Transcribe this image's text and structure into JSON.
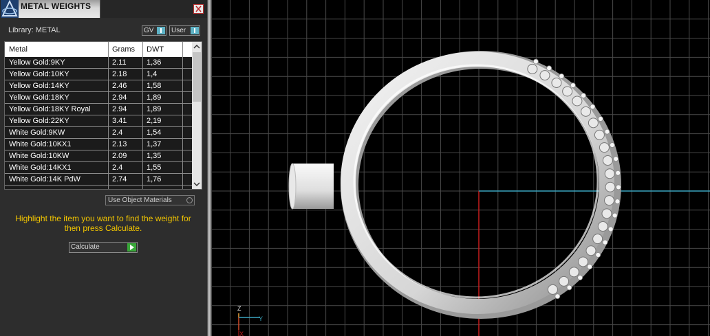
{
  "panel": {
    "title": "METAL WEIGHTS",
    "library_label": "Library: METAL",
    "toggle_gv": "GV",
    "toggle_user": "User",
    "columns": [
      "Metal",
      "Grams",
      "DWT"
    ],
    "rows": [
      {
        "metal": "Yellow Gold:9KY",
        "grams": "2.11",
        "dwt": "1,36"
      },
      {
        "metal": "Yellow Gold:10KY",
        "grams": "2.18",
        "dwt": "1,4"
      },
      {
        "metal": "Yellow Gold:14KY",
        "grams": "2.46",
        "dwt": "1,58"
      },
      {
        "metal": "Yellow Gold:18KY",
        "grams": "2.94",
        "dwt": "1,89"
      },
      {
        "metal": "Yellow Gold:18KY Royal",
        "grams": "2.94",
        "dwt": "1,89"
      },
      {
        "metal": "Yellow Gold:22KY",
        "grams": "3.41",
        "dwt": "2,19"
      },
      {
        "metal": "White Gold:9KW",
        "grams": "2.4",
        "dwt": "1,54"
      },
      {
        "metal": "White Gold:10KX1",
        "grams": "2.13",
        "dwt": "1,37"
      },
      {
        "metal": "White Gold:10KW",
        "grams": "2.09",
        "dwt": "1,35"
      },
      {
        "metal": "White Gold:14KX1",
        "grams": "2.4",
        "dwt": "1,55"
      },
      {
        "metal": "White Gold:14K PdW",
        "grams": "2.74",
        "dwt": "1,76"
      }
    ],
    "use_object_materials": "Use Object Materials",
    "instructions": "Highlight the item you want to find the weight for then press Calculate.",
    "calculate_label": "Calculate"
  },
  "viewport": {
    "axis_labels": {
      "z": "Z",
      "y": "Y",
      "x": "X"
    },
    "colors": {
      "grid": "#4a4a4a",
      "x_axis": "#c81e1e",
      "y_axis": "#3aa6c0",
      "background": "#000000"
    }
  }
}
